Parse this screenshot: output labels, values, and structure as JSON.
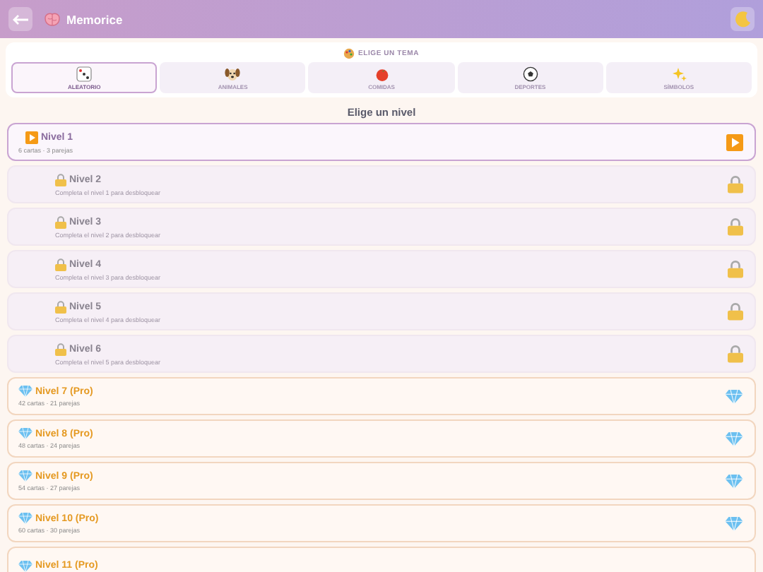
{
  "header": {
    "title": "Memorice"
  },
  "themes": {
    "heading": "ELIGE UN TEMA",
    "items": [
      {
        "label": "ALEATORIO",
        "selected": true
      },
      {
        "label": "ANIMALES",
        "selected": false
      },
      {
        "label": "COMIDAS",
        "selected": false
      },
      {
        "label": "DEPORTES",
        "selected": false
      },
      {
        "label": "SÍMBOLOS",
        "selected": false
      }
    ]
  },
  "levels_heading": "Elige un nivel",
  "levels": [
    {
      "kind": "unlocked",
      "title": "Nivel 1",
      "subtitle": "6 cartas · 3 parejas"
    },
    {
      "kind": "locked",
      "title": "Nivel 2",
      "subtitle": "Completa el nivel 1 para desbloquear"
    },
    {
      "kind": "locked",
      "title": "Nivel 3",
      "subtitle": "Completa el nivel 2 para desbloquear"
    },
    {
      "kind": "locked",
      "title": "Nivel 4",
      "subtitle": "Completa el nivel 3 para desbloquear"
    },
    {
      "kind": "locked",
      "title": "Nivel 5",
      "subtitle": "Completa el nivel 4 para desbloquear"
    },
    {
      "kind": "locked",
      "title": "Nivel 6",
      "subtitle": "Completa el nivel 5 para desbloquear"
    },
    {
      "kind": "pro",
      "title": "Nivel 7 (Pro)",
      "subtitle": "42 cartas · 21 parejas"
    },
    {
      "kind": "pro",
      "title": "Nivel 8 (Pro)",
      "subtitle": "48 cartas · 24 parejas"
    },
    {
      "kind": "pro",
      "title": "Nivel 9 (Pro)",
      "subtitle": "54 cartas · 27 parejas"
    },
    {
      "kind": "pro",
      "title": "Nivel 10 (Pro)",
      "subtitle": "60 cartas · 30 parejas"
    },
    {
      "kind": "pro",
      "title": "Nivel 11 (Pro)"
    }
  ]
}
